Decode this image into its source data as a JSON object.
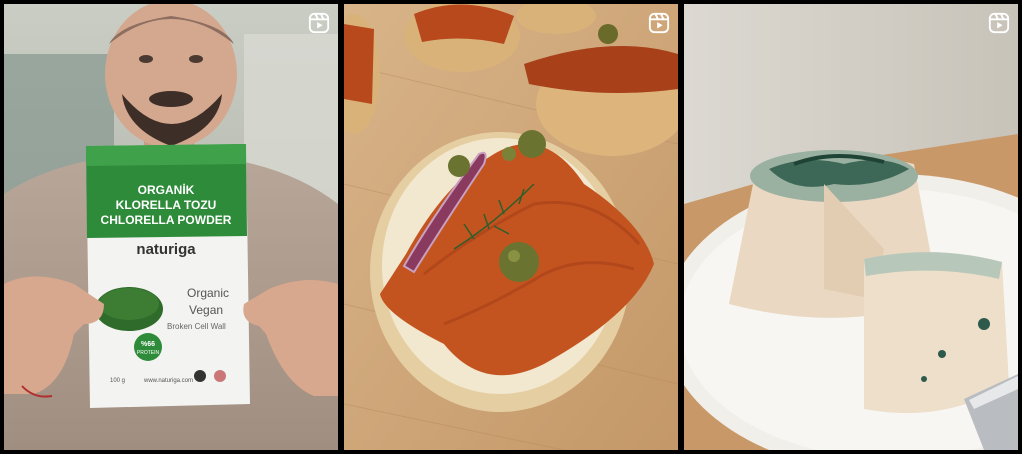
{
  "grid": {
    "posts": [
      {
        "type_icon": "reels-icon",
        "package": {
          "title_tr": "ORGANİK",
          "title_tr2": "KLORELLA TOZU",
          "title_en": "CHLORELLA POWDER",
          "brand": "naturiga",
          "organic": "Organic",
          "vegan": "Vegan",
          "broken_cell": "Broken Cell Wall",
          "protein_badge_line1": "%66",
          "protein_badge_line2": "PROTEIN",
          "weight": "100 g",
          "website": "www.naturiga.com"
        }
      },
      {
        "type_icon": "reels-icon"
      },
      {
        "type_icon": "reels-icon"
      }
    ]
  },
  "colors": {
    "package_green": "#2e8b3a",
    "chlorella_green": "#2f6b2a",
    "salmon_orange": "#c4541f",
    "wood": "#cfa77a",
    "cheese": "#ead8c2",
    "blue_vein": "#2d5a4a"
  }
}
